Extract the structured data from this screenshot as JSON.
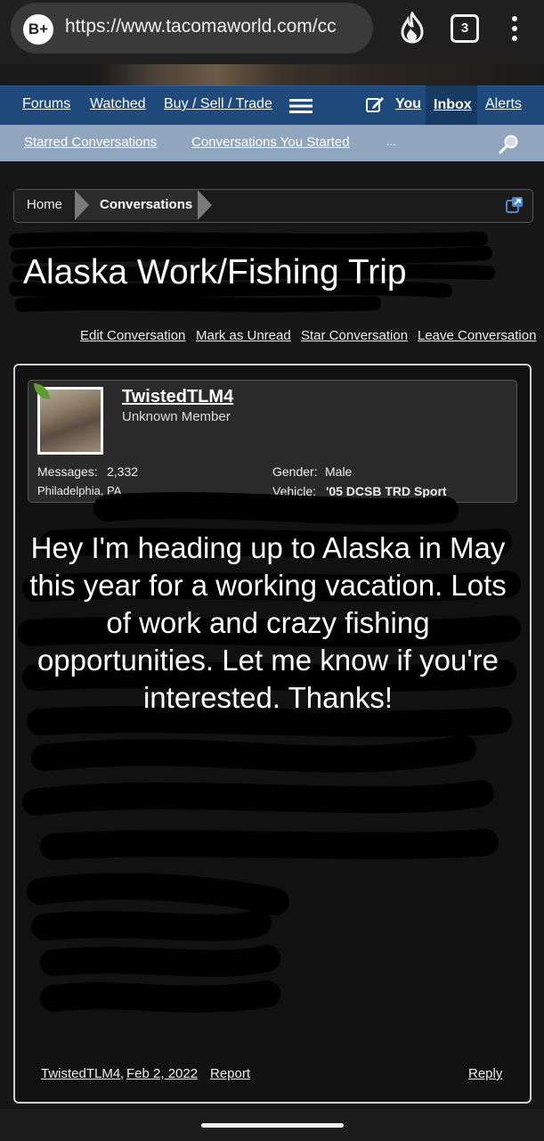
{
  "browser": {
    "site_icon_label": "B+",
    "url": "https://www.tacomaworld.com/cc",
    "tab_count": "3"
  },
  "nav": {
    "items": [
      "Forums",
      "Watched",
      "Buy / Sell / Trade"
    ],
    "you": "You",
    "inbox": "Inbox",
    "alerts": "Alerts"
  },
  "subnav": {
    "items": [
      "Starred Conversations",
      "Conversations You Started",
      "..."
    ]
  },
  "breadcrumb": {
    "home": "Home",
    "current": "Conversations"
  },
  "conversation": {
    "title": "Alaska Work/Fishing Trip",
    "actions": [
      "Edit Conversation",
      "Mark as Unread",
      "Star Conversation",
      "Leave Conversation"
    ]
  },
  "user": {
    "name": "TwistedTLM4",
    "title": "Unknown Member",
    "messages_label": "Messages:",
    "messages_value": "2,332",
    "location": "Philadelphia, PA",
    "gender_label": "Gender:",
    "gender_value": "Male",
    "vehicle_label": "Vehicle:",
    "vehicle_value": "'05 DCSB TRD Sport"
  },
  "message": {
    "text": "Hey I'm heading up to Alaska in May this year for a working vacation. Lots of work and crazy fishing opportunities. Let me know if you're interested. Thanks!",
    "author": "TwistedTLM4",
    "date": "Feb 2, 2022",
    "report": "Report",
    "reply": "Reply"
  },
  "icons": [
    "site-icon",
    "fire-icon",
    "tabs-icon",
    "menu-dots-icon",
    "hamburger-icon",
    "edit-icon",
    "search-icon",
    "popout-icon"
  ],
  "colors": {
    "nav_bg": "#1e4a7c",
    "subnav_bg": "#8fa6be",
    "page_bg": "#161616"
  }
}
